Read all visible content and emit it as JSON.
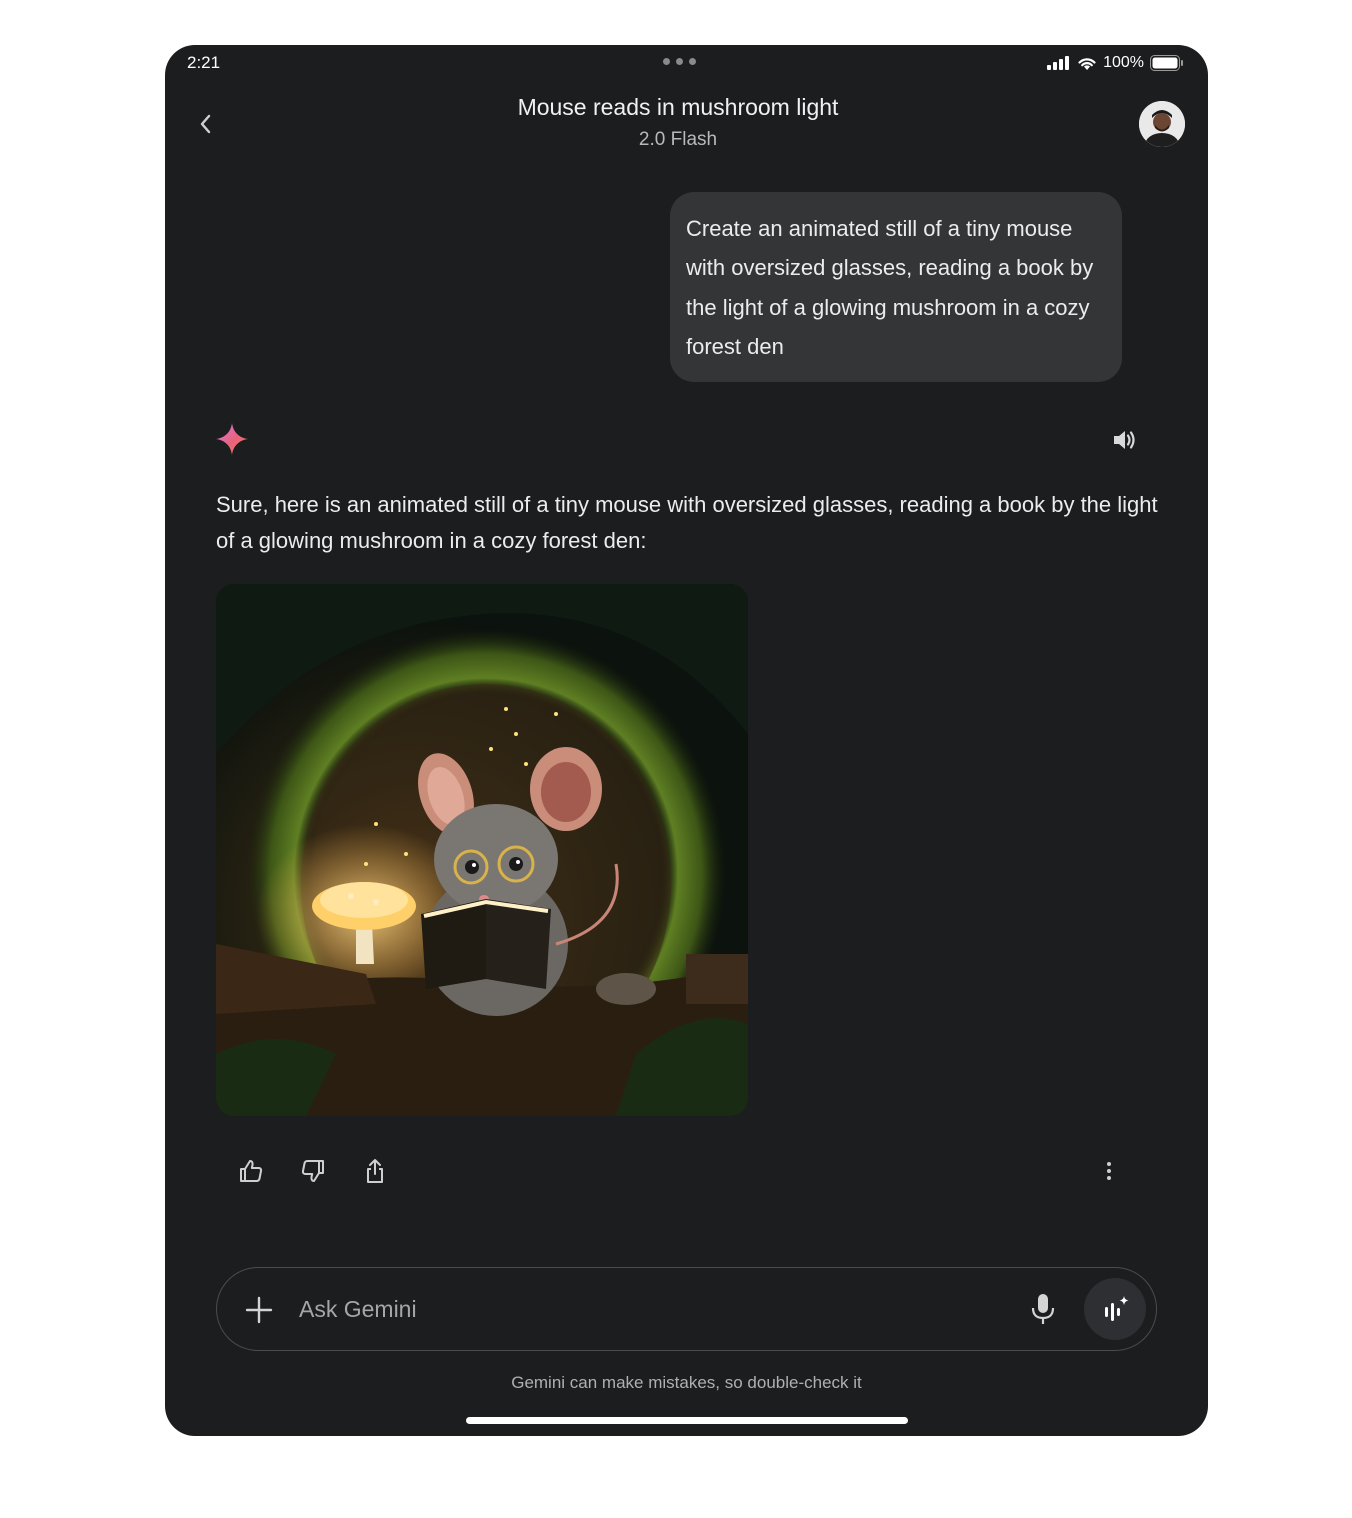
{
  "status_bar": {
    "time": "2:21",
    "battery": "100%"
  },
  "header": {
    "title": "Mouse reads in mushroom light",
    "model": "2.0 Flash"
  },
  "user_prompt": "Create an animated still of a tiny mouse with oversized glasses, reading a book by the light of a glowing mushroom in a cozy forest den",
  "response": {
    "text": "Sure, here is an animated still of a tiny mouse with oversized glasses, reading a book by the light of a glowing mushroom in a cozy forest den:"
  },
  "composer": {
    "placeholder": "Ask Gemini"
  },
  "footer": {
    "disclaimer": "Gemini can make mistakes, so double-check it"
  },
  "colors": {
    "background": "#1c1d1f",
    "bubble": "#333537",
    "accent_spark": "#e8627a"
  },
  "icons": [
    "back-icon",
    "avatar",
    "gemini-spark-icon",
    "speaker-icon",
    "thumbs-up-icon",
    "thumbs-down-icon",
    "share-icon",
    "more-vert-icon",
    "plus-icon",
    "mic-icon",
    "live-icon"
  ]
}
